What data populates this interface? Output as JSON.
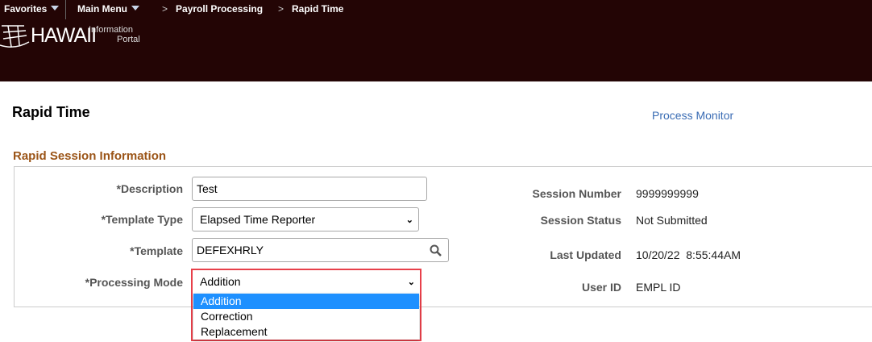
{
  "nav": {
    "favorites": "Favorites",
    "main_menu": "Main Menu",
    "breadcrumbs": [
      "Payroll Processing",
      "Rapid Time"
    ]
  },
  "logo": {
    "name": "HAWAII",
    "sub1": "Information",
    "sub2": "Portal"
  },
  "page_title": "Rapid Time",
  "process_monitor": "Process Monitor",
  "section_title": "Rapid Session Information",
  "form": {
    "description": {
      "label": "*Description",
      "value": "Test"
    },
    "template_type": {
      "label": "*Template Type",
      "value": "Elapsed Time Reporter"
    },
    "template": {
      "label": "*Template",
      "value": "DEFEXHRLY"
    },
    "processing_mode": {
      "label": "*Processing Mode",
      "value": "Addition",
      "options": [
        "Addition",
        "Correction",
        "Replacement"
      ]
    }
  },
  "info": {
    "session_number": {
      "label": "Session Number",
      "value": "9999999999"
    },
    "session_status": {
      "label": "Session Status",
      "value": "Not Submitted"
    },
    "last_updated": {
      "label": "Last Updated",
      "value": "10/20/22  8:55:44AM"
    },
    "user_id": {
      "label": "User ID",
      "value": "EMPL ID"
    }
  },
  "colors": {
    "header": "#230505",
    "section": "#9b5518",
    "link": "#3a6cb4",
    "highlight": "#1e90ff",
    "outline": "#e8404a"
  }
}
